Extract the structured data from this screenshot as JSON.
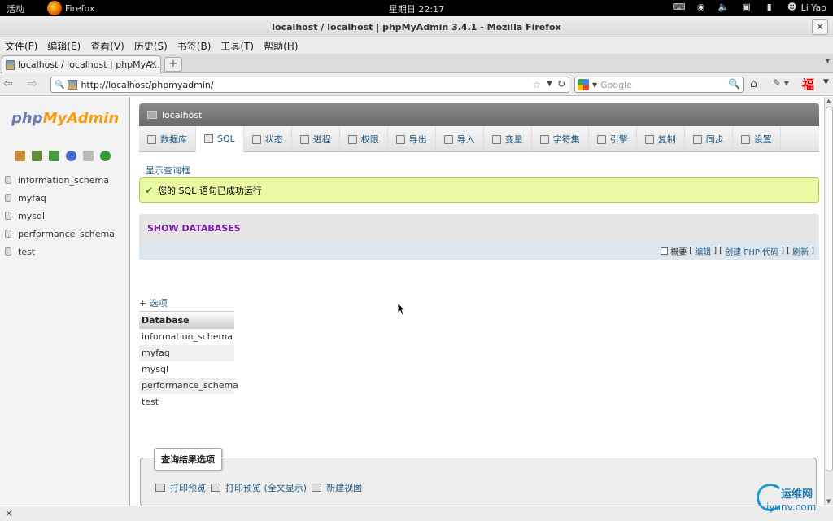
{
  "gnome": {
    "activities": "活动",
    "app_name": "Firefox",
    "clock": "星期日 22:17",
    "user": "Li Yao"
  },
  "window": {
    "title": "localhost / localhost | phpMyAdmin 3.4.1 - Mozilla Firefox"
  },
  "menubar": [
    "文件(F)",
    "编辑(E)",
    "查看(V)",
    "历史(S)",
    "书签(B)",
    "工具(T)",
    "帮助(H)"
  ],
  "tab": {
    "title": "localhost / localhost | phpMyA..."
  },
  "nav": {
    "url": "http://localhost/phpmyadmin/",
    "search_placeholder": "Google"
  },
  "sidebar": {
    "logo_php": "php",
    "logo_my": "My",
    "logo_admin": "Admin",
    "databases": [
      "information_schema",
      "myfaq",
      "mysql",
      "performance_schema",
      "test"
    ]
  },
  "main": {
    "server": "localhost",
    "tabs": [
      "数据库",
      "SQL",
      "状态",
      "进程",
      "权限",
      "导出",
      "导入",
      "变量",
      "字符集",
      "引擎",
      "复制",
      "同步",
      "设置"
    ],
    "active_tab": "SQL",
    "show_query_box": "显示查询框",
    "success_message": "您的 SQL 语句已成功运行",
    "sql_keyword": "SHOW",
    "sql_rest": "DATABASES",
    "sql_tools": {
      "profiling": "概要",
      "edit": "编辑",
      "create_php": "创建 PHP 代码",
      "refresh": "刷新"
    },
    "options_link": "+ 选项",
    "result_header": "Database",
    "result_rows": [
      "information_schema",
      "myfaq",
      "mysql",
      "performance_schema",
      "test"
    ],
    "result_options": {
      "legend": "查询结果选项",
      "print_view": "打印预览",
      "print_view_full": "打印预览 (全文显示)",
      "create_view": "新建视图"
    }
  },
  "watermark": {
    "cn": "运维网",
    "en": "iyunv.com"
  }
}
